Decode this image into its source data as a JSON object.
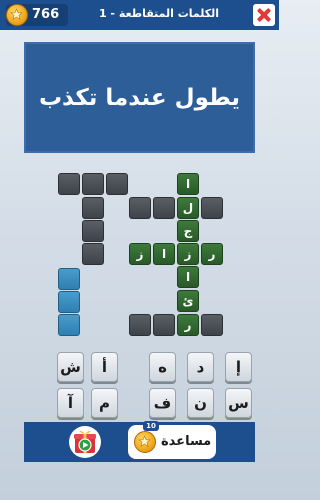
{
  "header": {
    "coins": "766",
    "title": "1 - الكلمات المتقاطعة"
  },
  "clue": {
    "text": "يطول عندما تكذب"
  },
  "grid": {
    "revealed_letters": [
      "ا",
      "ل",
      "ج",
      "ر",
      "ز",
      "ا",
      "ز",
      "ا",
      "ئ",
      "ر"
    ]
  },
  "keyboard": {
    "row1": [
      "إ",
      "د",
      "ه",
      "أ",
      "ش"
    ],
    "row2": [
      "س",
      "ن",
      "ف",
      "م",
      "آ"
    ]
  },
  "footer": {
    "help_label": "مساعدة",
    "help_cost": "10"
  },
  "colors": {
    "header_bg": "#1d4f8f",
    "clue_bg": "#2e5e98",
    "solved_cell": "#2f6a2f",
    "empty_cell": "#4a4f55",
    "highlight_cell": "#3c8cbe"
  },
  "icons": {
    "coin": "star-coin-icon",
    "close": "close-icon",
    "gift": "gift-play-icon"
  }
}
